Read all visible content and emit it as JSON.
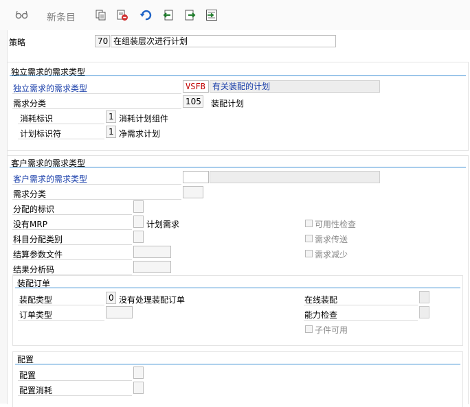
{
  "toolbar": {
    "new_entries_label": "新条目",
    "icons": [
      "glasses-icon",
      "copy-icon",
      "delete-icon",
      "undo-icon",
      "previous-entry-icon",
      "next-entry-icon",
      "select-icon"
    ]
  },
  "strategy": {
    "label": "策略",
    "code": "70",
    "description": "在组装层次进行计划"
  },
  "independent": {
    "title": "独立需求的需求类型",
    "req_type_label": "独立需求的需求类型",
    "req_type_code": "VSFB",
    "req_type_desc": "有关装配的计划",
    "req_class_label": "需求分类",
    "req_class_code": "105",
    "req_class_desc": "装配计划",
    "consumption_label": "消耗标识",
    "consumption_code": "1",
    "consumption_desc": "消耗计划组件",
    "planning_label": "计划标识符",
    "planning_code": "1",
    "planning_desc": "净需求计划"
  },
  "customer": {
    "title": "客户需求的需求类型",
    "req_type_label": "客户需求的需求类型",
    "req_type_code": "",
    "req_type_desc": "",
    "req_class_label": "需求分类",
    "alloc_label": "分配的标识",
    "nomrp_label": "没有MRP",
    "nomrp_desc": "计划需求",
    "acct_label": "科目分配类别",
    "settle_label": "结算参数文件",
    "result_label": "结果分析码",
    "avail_check_label": "可用性检查",
    "req_transfer_label": "需求传送",
    "req_reduction_label": "需求减少"
  },
  "assembly": {
    "title": "装配订单",
    "type_label": "装配类型",
    "type_code": "0",
    "type_desc": "没有处理装配订单",
    "order_type_label": "订单类型",
    "online_label": "在线装配",
    "capacity_label": "能力检查",
    "components_label": "子件可用"
  },
  "config": {
    "title": "配置",
    "config_label": "配置",
    "consumption_label": "配置消耗"
  },
  "colors": {
    "accent": "#3b8fd4",
    "required_label": "#1a3faa",
    "code_red": "#c00000"
  }
}
